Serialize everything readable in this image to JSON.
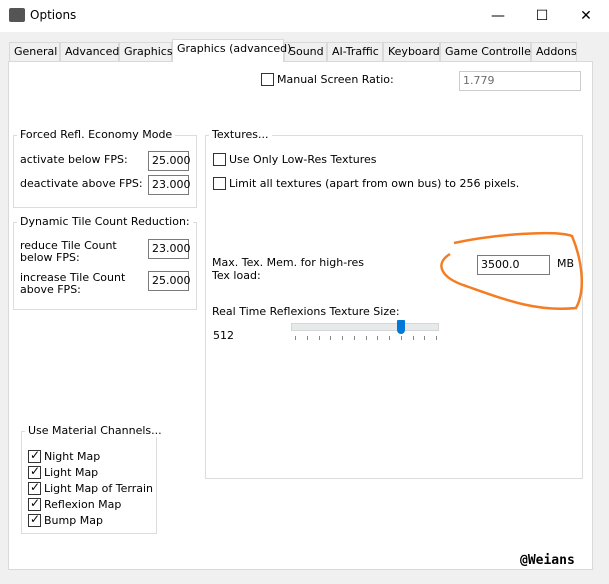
{
  "window": {
    "title": "Options",
    "minimize": "—",
    "maximize": "☐",
    "close": "✕"
  },
  "tabs": [
    "General",
    "Advanced",
    "Graphics",
    "Graphics (advanced)",
    "Sound",
    "AI-Traffic",
    "Keyboard",
    "Game Controller",
    "Addons"
  ],
  "active_tab": "Graphics (advanced)",
  "screen_ratio": {
    "label": "Manual Screen Ratio:",
    "checked": false,
    "value": "1.779"
  },
  "forced_refl": {
    "title": "Forced Refl. Economy Mode",
    "activate_label": "activate below FPS:",
    "activate_value": "25.000",
    "deactivate_label": "deactivate above FPS:",
    "deactivate_value": "23.000"
  },
  "tile_count": {
    "title": "Dynamic Tile Count Reduction:",
    "reduce_label": "reduce Tile Count below FPS:",
    "reduce_value": "23.000",
    "increase_label": "increase Tile Count above FPS:",
    "increase_value": "25.000"
  },
  "textures": {
    "title": "Textures...",
    "low_res_label": "Use Only Low-Res Textures",
    "limit_label": "Limit all textures (apart from own bus) to 256 pixels.",
    "max_mem_label": "Max. Tex. Mem. for high-res Tex load:",
    "max_mem_value": "3500.0",
    "max_mem_unit": "MB",
    "reflex_label": "Real Time Reflexions Texture Size:",
    "reflex_value": "512",
    "slider_fraction": 0.75,
    "slider_ticks": 13
  },
  "material": {
    "title": "Use Material Channels...",
    "items": [
      {
        "label": "Night Map",
        "checked": true
      },
      {
        "label": "Light Map",
        "checked": true
      },
      {
        "label": "Light Map of Terrain",
        "checked": true
      },
      {
        "label": "Reflexion Map",
        "checked": true
      },
      {
        "label": "Bump Map",
        "checked": true
      }
    ]
  },
  "watermark": "@Weians",
  "annotation_color": "#f57c22"
}
